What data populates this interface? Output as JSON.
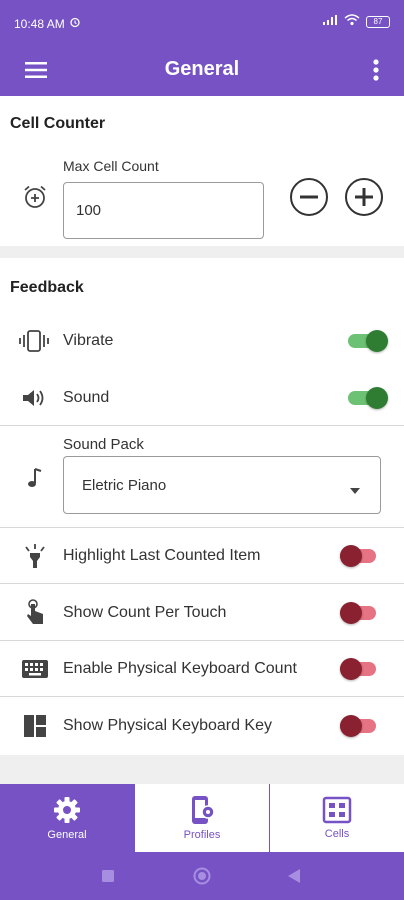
{
  "status_bar": {
    "time": "10:48 AM",
    "battery": "87"
  },
  "app_bar": {
    "title": "General"
  },
  "cell_counter": {
    "section_title": "Cell Counter",
    "max_cell_count_label": "Max Cell Count",
    "max_cell_count_value": "100"
  },
  "feedback": {
    "section_title": "Feedback",
    "vibrate_label": "Vibrate",
    "vibrate_on": true,
    "sound_label": "Sound",
    "sound_on": true,
    "sound_pack_label": "Sound Pack",
    "sound_pack_value": "Eletric Piano",
    "highlight_label": "Highlight Last Counted Item",
    "highlight_on": false,
    "count_per_touch_label": "Show Count Per Touch",
    "count_per_touch_on": false,
    "keyboard_count_label": "Enable Physical Keyboard Count",
    "keyboard_count_on": false,
    "keyboard_key_label": "Show Physical Keyboard Key",
    "keyboard_key_on": false
  },
  "bottom_nav": {
    "items": [
      {
        "label": "General",
        "icon": "gear-icon",
        "active": true
      },
      {
        "label": "Profiles",
        "icon": "phone-settings-icon",
        "active": false
      },
      {
        "label": "Cells",
        "icon": "grid-icon",
        "active": false
      }
    ]
  },
  "colors": {
    "primary": "#7652c4",
    "toggle_on": "#2e7d32",
    "toggle_off": "#8a2130"
  }
}
